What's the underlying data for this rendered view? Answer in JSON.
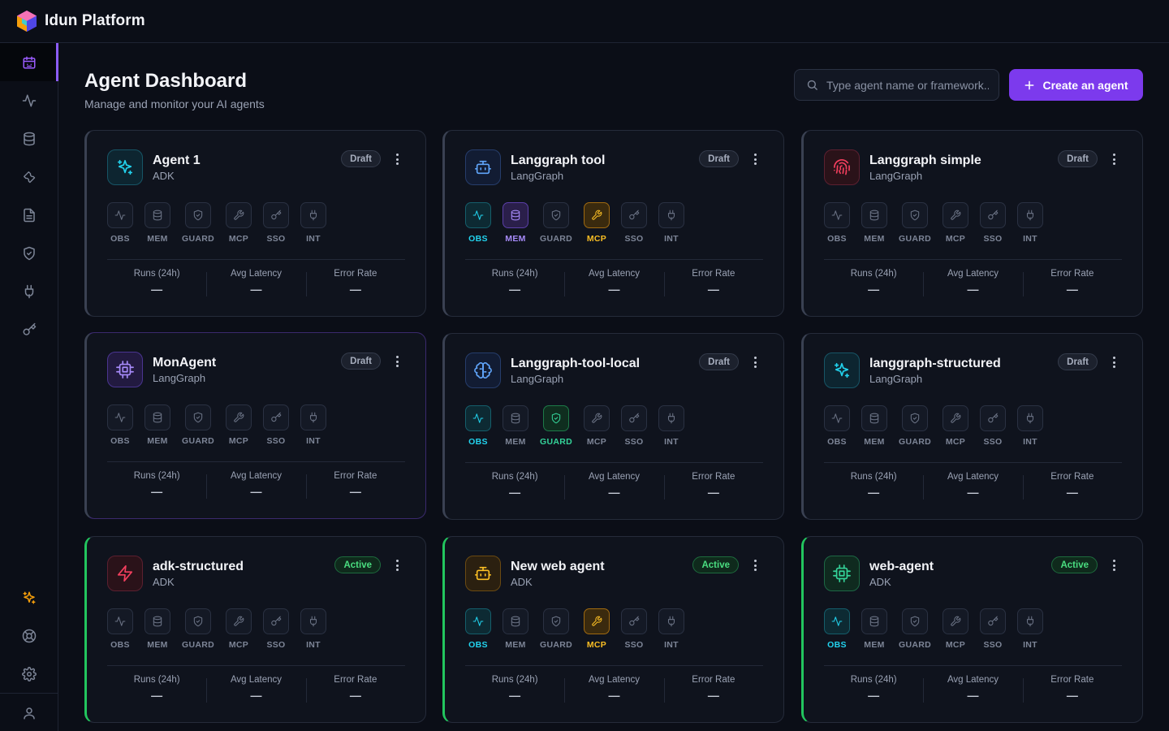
{
  "app": {
    "title": "Idun Platform"
  },
  "header": {
    "title": "Agent Dashboard",
    "subtitle": "Manage and monitor your AI agents",
    "search_placeholder": "Type agent name or framework...",
    "create_label": "Create an agent"
  },
  "sidebar": {
    "items": [
      {
        "icon": "calendar-bot-icon",
        "active": true
      },
      {
        "icon": "activity-icon"
      },
      {
        "icon": "database-icon"
      },
      {
        "icon": "wrench-icon"
      },
      {
        "icon": "document-icon"
      },
      {
        "icon": "shield-icon"
      },
      {
        "icon": "plug-icon"
      },
      {
        "icon": "key-icon"
      }
    ],
    "bottom_items": [
      {
        "icon": "sparkles-icon"
      },
      {
        "icon": "help-lifebuoy-icon"
      },
      {
        "icon": "settings-gear-icon"
      },
      {
        "icon": "user-icon"
      }
    ]
  },
  "capability_labels": [
    "OBS",
    "MEM",
    "GUARD",
    "MCP",
    "SSO",
    "INT"
  ],
  "stat_labels": [
    "Runs (24h)",
    "Avg Latency",
    "Error Rate"
  ],
  "colors": {
    "accent": "#7c3aed",
    "active_green": "#22c55e",
    "obs_cyan": "#22d3ee",
    "mem_purple": "#a78bfa",
    "mcp_amber": "#fbbf24",
    "guard_green": "#34d399"
  },
  "agents": [
    {
      "name": "Agent 1",
      "framework": "ADK",
      "status": "Draft",
      "icon": "sparkles-icon",
      "icon_color": "cyan",
      "enabled": [],
      "stats": [
        "—",
        "—",
        "—"
      ]
    },
    {
      "name": "Langgraph tool",
      "framework": "LangGraph",
      "status": "Draft",
      "icon": "bot-icon",
      "icon_color": "blue",
      "enabled": [
        "OBS",
        "MEM",
        "MCP"
      ],
      "stats": [
        "—",
        "—",
        "—"
      ]
    },
    {
      "name": "Langgraph simple",
      "framework": "LangGraph",
      "status": "Draft",
      "icon": "fingerprint-icon",
      "icon_color": "red",
      "enabled": [],
      "stats": [
        "—",
        "—",
        "—"
      ]
    },
    {
      "name": "MonAgent",
      "framework": "LangGraph",
      "status": "Draft",
      "icon": "cpu-icon",
      "icon_color": "purple",
      "enabled": [],
      "stats": [
        "—",
        "—",
        "—"
      ]
    },
    {
      "name": "Langgraph-tool-local",
      "framework": "LangGraph",
      "status": "Draft",
      "icon": "brain-icon",
      "icon_color": "blue",
      "enabled": [
        "OBS",
        "GUARD"
      ],
      "stats": [
        "—",
        "—",
        "—"
      ]
    },
    {
      "name": "langgraph-structured",
      "framework": "LangGraph",
      "status": "Draft",
      "icon": "sparkles-icon",
      "icon_color": "cyan",
      "enabled": [],
      "stats": [
        "—",
        "—",
        "—"
      ]
    },
    {
      "name": "adk-structured",
      "framework": "ADK",
      "status": "Active",
      "icon": "zap-icon",
      "icon_color": "red",
      "enabled": [],
      "stats": [
        "—",
        "—",
        "—"
      ]
    },
    {
      "name": "New web agent",
      "framework": "ADK",
      "status": "Active",
      "icon": "bot-icon",
      "icon_color": "amber",
      "enabled": [
        "OBS",
        "MCP"
      ],
      "stats": [
        "—",
        "—",
        "—"
      ]
    },
    {
      "name": "web-agent",
      "framework": "ADK",
      "status": "Active",
      "icon": "cpu-icon",
      "icon_color": "green",
      "enabled": [
        "OBS"
      ],
      "stats": [
        "—",
        "—",
        "—"
      ]
    }
  ]
}
